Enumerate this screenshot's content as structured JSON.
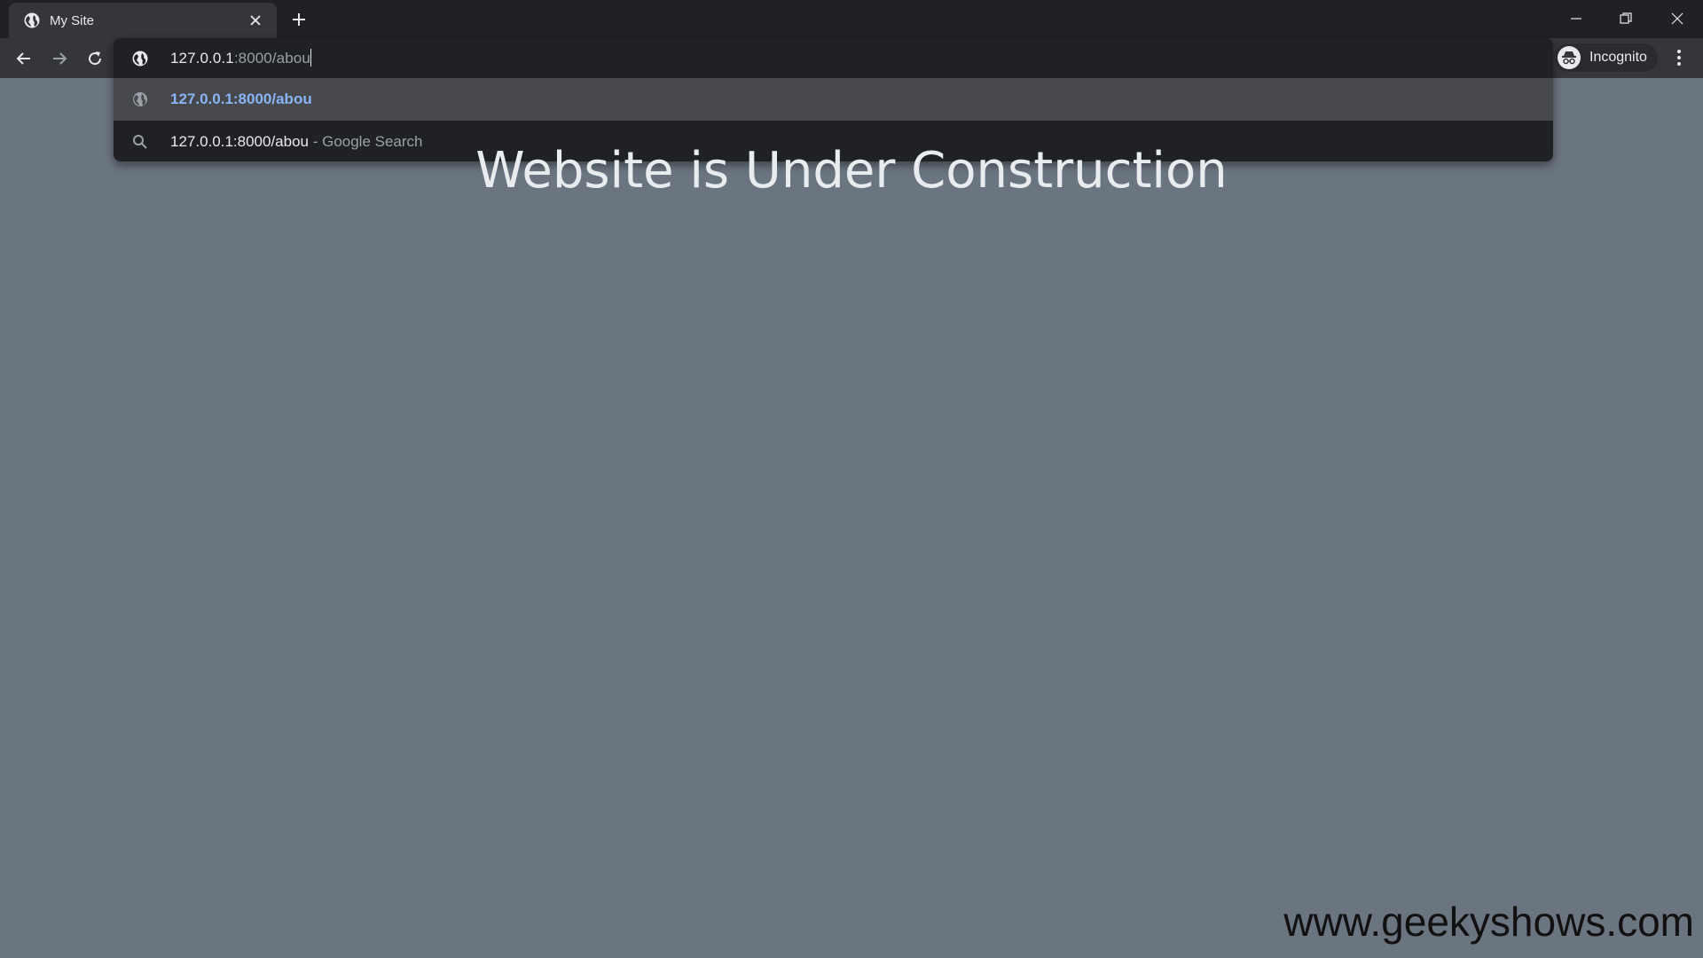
{
  "browser": {
    "tab": {
      "title": "My Site",
      "icon": "globe-icon"
    },
    "new_tab_icon": "plus-icon",
    "window_controls": [
      "minimize-icon",
      "restore-icon",
      "close-icon"
    ],
    "nav": [
      "back-arrow-icon",
      "forward-arrow-icon",
      "reload-icon"
    ],
    "profile": {
      "label": "Incognito",
      "icon": "incognito-icon"
    },
    "menu_icon": "kebab-menu-icon"
  },
  "omnibox": {
    "input_typed": "127.0.0.1",
    "input_rest": ":8000/abou",
    "suggestions": [
      {
        "icon": "globe-icon",
        "text": "127.0.0.1:8000/abou",
        "selected": true
      },
      {
        "icon": "search-icon",
        "text": "127.0.0.1:8000/abou",
        "suffix": " - Google Search",
        "selected": false
      }
    ]
  },
  "page": {
    "heading": "Website is Under Construction",
    "watermark": "www.geekyshows.com",
    "background": "#6b7580"
  }
}
